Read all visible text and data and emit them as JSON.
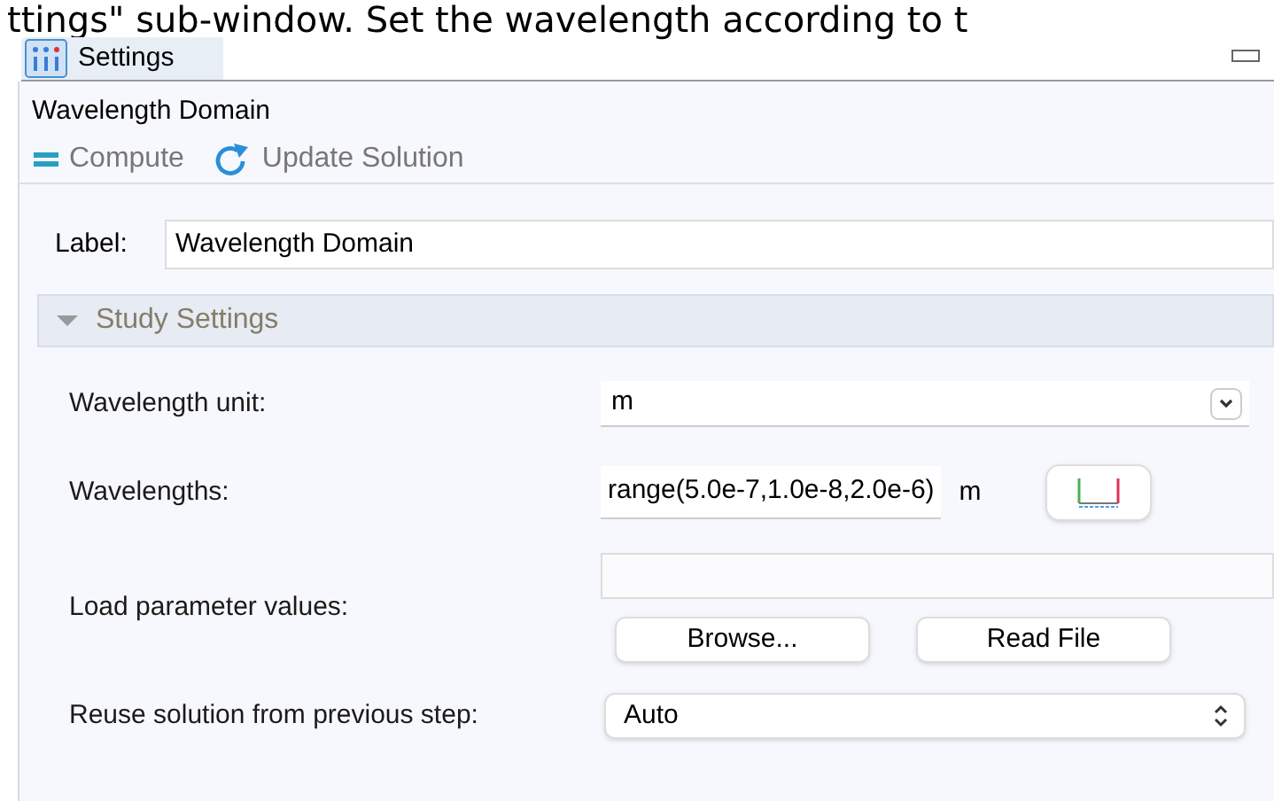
{
  "caption": "ttings\" sub-window. Set the wavelength according to t",
  "window": {
    "tab": "Settings",
    "title": "Wavelength Domain"
  },
  "toolbar": [
    {
      "kind": "compute",
      "label": "Compute"
    },
    {
      "kind": "update",
      "label": "Update Solution"
    }
  ],
  "label_field": {
    "label": "Label:",
    "value": "Wavelength Domain"
  },
  "section": {
    "title": "Study Settings",
    "expanded": true
  },
  "rows": [
    {
      "kind": "select",
      "label": "Wavelength unit:",
      "value": "m"
    },
    {
      "kind": "expression",
      "label": "Wavelengths:",
      "value": "range(5.0e-7,1.0e-8,2.0e-6)",
      "unit": "m"
    },
    {
      "kind": "file",
      "label": "Load parameter values:",
      "buttons": [
        "Browse...",
        "Read File"
      ]
    },
    {
      "kind": "stepper",
      "label": "Reuse solution from previous step:",
      "value": "Auto"
    }
  ]
}
